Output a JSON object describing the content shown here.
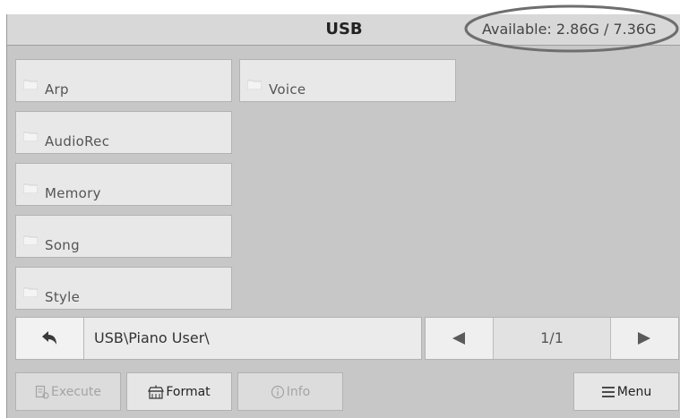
{
  "header": {
    "title": "USB",
    "storage": "Available: 2.86G / 7.36G"
  },
  "folders": [
    {
      "label": "Arp"
    },
    {
      "label": "AudioRec"
    },
    {
      "label": "Memory"
    },
    {
      "label": "Song"
    },
    {
      "label": "Style"
    },
    {
      "label": "Voice"
    }
  ],
  "path": {
    "text": "USB\\Piano User\\"
  },
  "pager": {
    "page": "1/1"
  },
  "toolbar": {
    "execute": "Execute",
    "format": "Format",
    "info": "Info",
    "menu": "Menu"
  },
  "colors": {
    "screen_bg": "#c7c7c7",
    "folder_bg": "#e8e8e8",
    "oval_stroke": "#6e6e6e"
  }
}
